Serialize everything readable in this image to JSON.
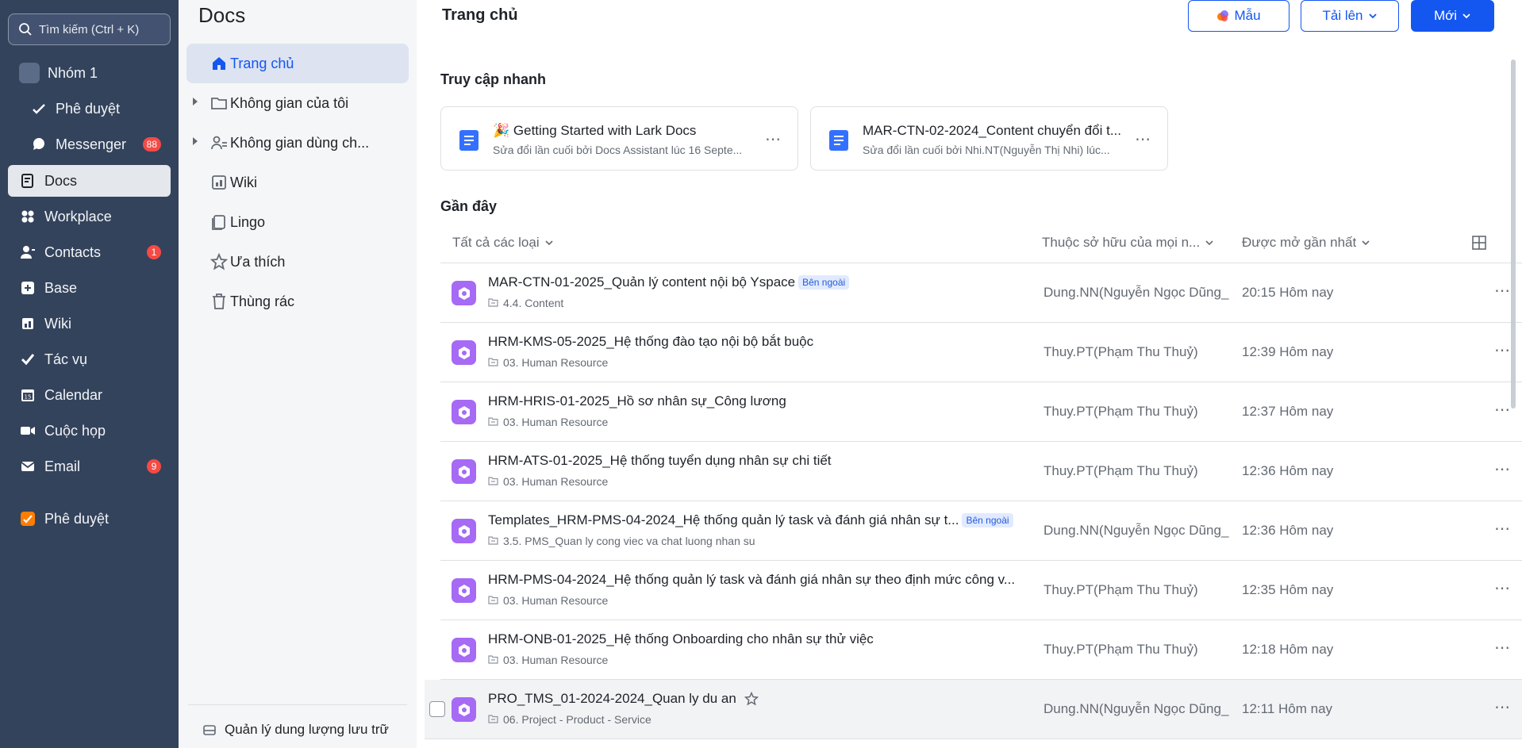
{
  "nav": {
    "search_placeholder": "Tìm kiếm (Ctrl + K)",
    "group": "Nhóm 1",
    "items": [
      {
        "label": "Phê duyệt",
        "icon": "approval-check-icon"
      },
      {
        "label": "Messenger",
        "icon": "messenger-icon",
        "badge": "88"
      },
      {
        "label": "Docs",
        "icon": "docs-icon",
        "active": true
      },
      {
        "label": "Workplace",
        "icon": "workplace-icon"
      },
      {
        "label": "Contacts",
        "icon": "contacts-icon",
        "badge": "1"
      },
      {
        "label": "Base",
        "icon": "base-icon"
      },
      {
        "label": "Wiki",
        "icon": "wiki-icon"
      },
      {
        "label": "Tác vụ",
        "icon": "tasks-icon"
      },
      {
        "label": "Calendar",
        "icon": "calendar-icon"
      },
      {
        "label": "Cuộc họp",
        "icon": "meeting-icon"
      },
      {
        "label": "Email",
        "icon": "email-icon",
        "badge": "9"
      },
      {
        "label": "Phê duyệt",
        "icon": "approval-app-icon"
      }
    ]
  },
  "side": {
    "title": "Docs",
    "items": [
      {
        "label": "Trang chủ",
        "active": true
      },
      {
        "label": "Không gian của tôi"
      },
      {
        "label": "Không gian dùng ch..."
      },
      {
        "label": "Wiki"
      },
      {
        "label": "Lingo"
      },
      {
        "label": "Ưa thích"
      },
      {
        "label": "Thùng rác"
      }
    ],
    "storage": "Quản lý dung lượng lưu trữ"
  },
  "main": {
    "title": "Trang chủ",
    "buttons": {
      "template": "Mẫu",
      "upload": "Tải lên",
      "new": "Mới"
    },
    "quick_access_title": "Truy cập nhanh",
    "quick_cards": [
      {
        "title": "🎉 Getting Started with Lark Docs",
        "subtitle": "Sửa đổi lần cuối bởi Docs Assistant lúc 16 Septe..."
      },
      {
        "title": "MAR-CTN-02-2024_Content chuyển đổi t...",
        "subtitle": "Sửa đổi lần cuối bởi Nhi.NT(Nguyễn Thị Nhi) lúc..."
      }
    ],
    "recent_title": "Gần đây",
    "columns": {
      "type": "Tất cả các loại",
      "owner": "Thuộc sở hữu của mọi n...",
      "opened": "Được mở gần nhất"
    },
    "rows": [
      {
        "name": "MAR-CTN-01-2025_Quản lý content nội bộ Yspace",
        "tag": "Bên ngoài",
        "location": "4.4. Content",
        "owner": "Dung.NN(Nguyễn Ngọc Dũng_",
        "time": "20:15 Hôm nay"
      },
      {
        "name": "HRM-KMS-05-2025_Hệ thống đào tạo nội bộ bắt buộc",
        "tag": "",
        "location": "03. Human Resource",
        "owner": "Thuy.PT(Phạm Thu Thuỷ)",
        "time": "12:39 Hôm nay"
      },
      {
        "name": "HRM-HRIS-01-2025_Hồ sơ nhân sự_Công lương",
        "tag": "",
        "location": "03. Human Resource",
        "owner": "Thuy.PT(Phạm Thu Thuỷ)",
        "time": "12:37 Hôm nay"
      },
      {
        "name": "HRM-ATS-01-2025_Hệ thống tuyển dụng nhân sự chi tiết",
        "tag": "",
        "location": "03. Human Resource",
        "owner": "Thuy.PT(Phạm Thu Thuỷ)",
        "time": "12:36 Hôm nay"
      },
      {
        "name": "Templates_HRM-PMS-04-2024_Hệ thống quản lý task và đánh giá nhân sự t...",
        "tag": "Bên ngoài",
        "location": "3.5. PMS_Quan ly cong viec va chat luong nhan su",
        "owner": "Dung.NN(Nguyễn Ngọc Dũng_",
        "time": "12:36 Hôm nay"
      },
      {
        "name": "HRM-PMS-04-2024_Hệ thống quản lý task và đánh giá nhân sự theo định mức công v...",
        "tag": "",
        "location": "03. Human Resource",
        "owner": "Thuy.PT(Phạm Thu Thuỷ)",
        "time": "12:35 Hôm nay"
      },
      {
        "name": "HRM-ONB-01-2025_Hệ thống Onboarding cho nhân sự thử việc",
        "tag": "",
        "location": "03. Human Resource",
        "owner": "Thuy.PT(Phạm Thu Thuỷ)",
        "time": "12:18 Hôm nay"
      },
      {
        "name": "PRO_TMS_01-2024-2024_Quan ly du an",
        "tag": "",
        "location": "06. Project - Product - Service",
        "owner": "Dung.NN(Nguyễn Ngọc Dũng_",
        "time": "12:11 Hôm nay"
      }
    ]
  },
  "colors": {
    "nav_bg": "#34435c",
    "accent": "#1456f0",
    "doc_icon": "#a66af5",
    "badge": "#f54a45"
  }
}
